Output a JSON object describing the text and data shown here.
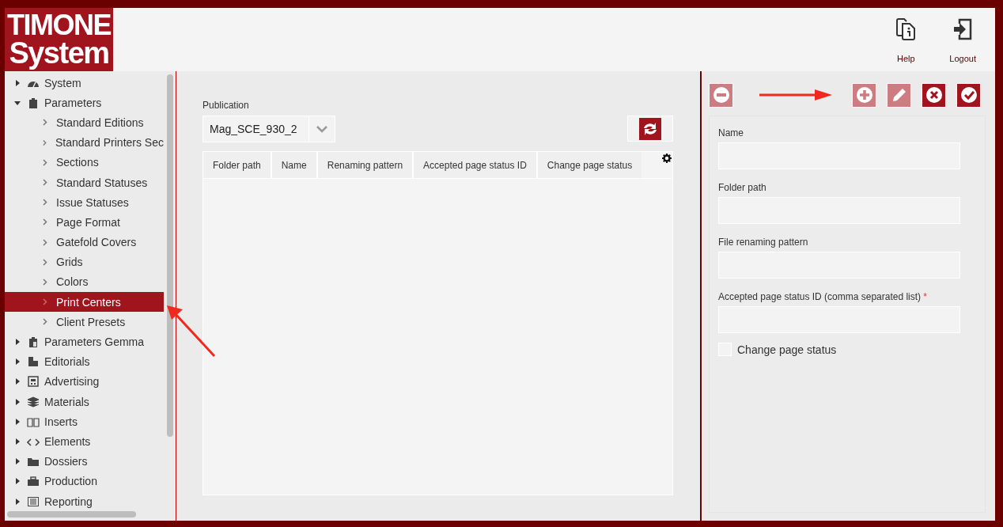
{
  "logo": {
    "line1": "TIMONE",
    "line2": "System"
  },
  "header_actions": [
    {
      "kind": "help",
      "label": "Help"
    },
    {
      "kind": "logout",
      "label": "Logout"
    }
  ],
  "sidebar": {
    "items": [
      {
        "label": "System",
        "expanded": false,
        "selected": false
      },
      {
        "label": "Parameters",
        "expanded": true,
        "selected": false,
        "children": [
          {
            "label": "Standard Editions",
            "selected": false
          },
          {
            "label": "Standard Printers Sec",
            "selected": false
          },
          {
            "label": "Sections",
            "selected": false
          },
          {
            "label": "Standard Statuses",
            "selected": false
          },
          {
            "label": "Issue Statuses",
            "selected": false
          },
          {
            "label": "Page Format",
            "selected": false
          },
          {
            "label": "Gatefold Covers",
            "selected": false
          },
          {
            "label": "Grids",
            "selected": false
          },
          {
            "label": "Colors",
            "selected": false
          },
          {
            "label": "Print Centers",
            "selected": true
          },
          {
            "label": "Client Presets",
            "selected": false
          }
        ]
      },
      {
        "label": "Parameters Gemma",
        "expanded": false,
        "selected": false
      },
      {
        "label": "Editorials",
        "expanded": false,
        "selected": false
      },
      {
        "label": "Advertising",
        "expanded": false,
        "selected": false
      },
      {
        "label": "Materials",
        "expanded": false,
        "selected": false
      },
      {
        "label": "Inserts",
        "expanded": false,
        "selected": false
      },
      {
        "label": "Elements",
        "expanded": false,
        "selected": false
      },
      {
        "label": "Dossiers",
        "expanded": false,
        "selected": false
      },
      {
        "label": "Production",
        "expanded": false,
        "selected": false
      },
      {
        "label": "Reporting",
        "expanded": false,
        "selected": false
      }
    ]
  },
  "publication": {
    "label": "Publication",
    "value": "Mag_SCE_930_2"
  },
  "table": {
    "columns": [
      "Folder path",
      "Name",
      "Renaming pattern",
      "Accepted page status ID",
      "Change page status"
    ]
  },
  "toolbar": [
    {
      "kind": "remove",
      "disabled": true
    },
    {
      "kind": "add",
      "disabled": true
    },
    {
      "kind": "edit",
      "disabled": true
    },
    {
      "kind": "cancel",
      "disabled": false
    },
    {
      "kind": "confirm",
      "disabled": false
    }
  ],
  "form": {
    "fields": [
      {
        "label": "Name"
      },
      {
        "label": "Folder path"
      },
      {
        "label": "File renaming pattern"
      },
      {
        "label": "Accepted page status ID (comma separated list)",
        "required_mark": "*"
      }
    ],
    "checkbox": {
      "label": "Change page status",
      "checked": false
    }
  }
}
